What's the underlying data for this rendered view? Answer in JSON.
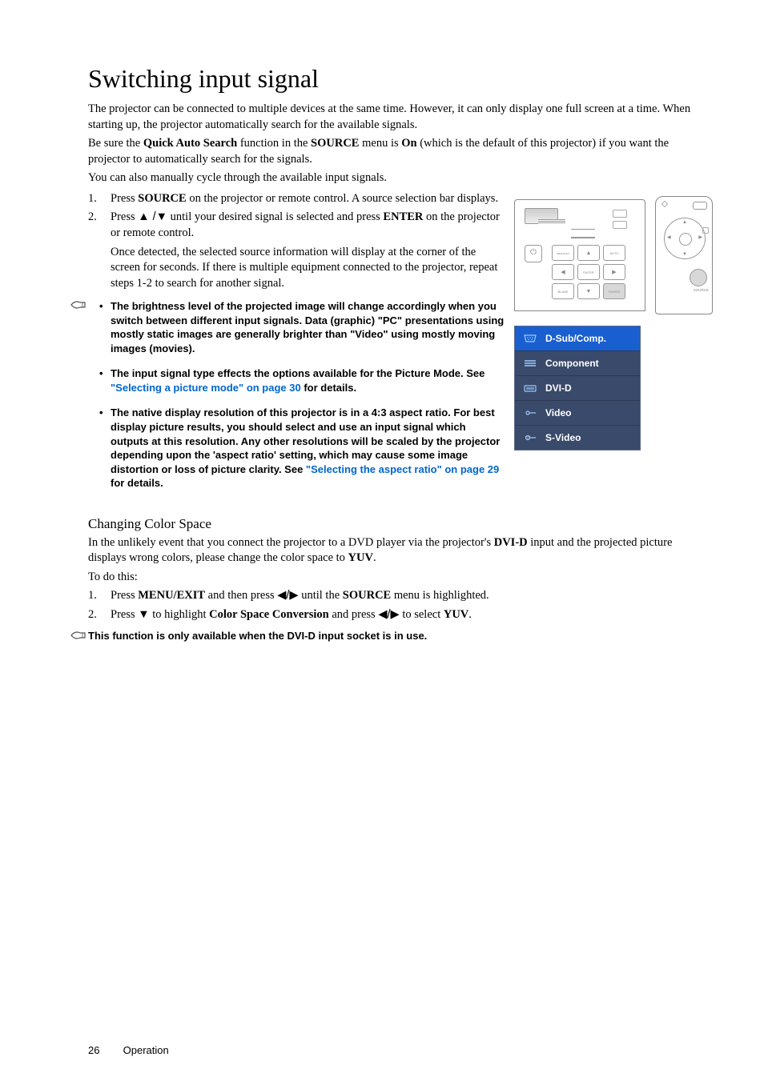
{
  "title": "Switching input signal",
  "intro1": "The projector can be connected to multiple devices at the same time. However, it can only display one full screen at a time. When starting up, the projector automatically search for the available signals.",
  "intro2a": "Be sure the ",
  "intro2b": "Quick Auto Search",
  "intro2c": " function in the ",
  "intro2d": "SOURCE",
  "intro2e": " menu is ",
  "intro2f": "On",
  "intro2g": " (which is the default of this projector) if you want the projector to automatically search for the signals.",
  "intro3": "You can also manually cycle through the available input signals.",
  "step1n": "1.",
  "step1a": "Press ",
  "step1b": "SOURCE",
  "step1c": " on the projector or remote control. A source selection bar displays.",
  "step2n": "2.",
  "step2a": "Press ",
  "step2b": " until your desired signal is selected and press ",
  "step2c": "ENTER",
  "step2d": " on the projector or remote control.",
  "step2cont": "Once detected, the selected source information will display at the corner of the screen for seconds. If there is multiple equipment connected to the projector, repeat steps 1-2 to search for another signal.",
  "bullet1": "The brightness level of the projected image will change accordingly when you switch between different input signals. Data (graphic) \"PC\" presentations using mostly static images are generally brighter than \"Video\" using mostly moving images (movies).",
  "bullet2a": "The input signal type effects the options available for the Picture Mode. See ",
  "bullet2link": "\"Selecting a picture mode\" on page 30",
  "bullet2b": " for details.",
  "bullet3a": "The native display resolution of this projector is in a 4:3 aspect ratio. For best display picture results, you should select and use an input signal which outputs at this resolution. Any other resolutions will be scaled by the projector depending upon the 'aspect ratio' setting, which may cause some image distortion or loss of picture clarity. See ",
  "bullet3link": "\"Selecting the aspect ratio\" on page 29",
  "bullet3b": " for details.",
  "subheading": "Changing Color Space",
  "ccs1a": "In the unlikely event that you connect the projector to a DVD player via the projector's ",
  "ccs1b": "DVI-D",
  "ccs1c": " input and the projected picture displays wrong colors, please change the color space to ",
  "ccs1d": "YUV",
  "ccs1e": ".",
  "ccs2": "To do this:",
  "cstep1n": "1.",
  "cstep1a": "Press ",
  "cstep1b": "MENU/EXIT",
  "cstep1c": " and then press ",
  "cstep1d": " until the ",
  "cstep1e": "SOURCE",
  "cstep1f": " menu is highlighted.",
  "cstep2n": "2.",
  "cstep2a": "Press ",
  "cstep2b": " to highlight ",
  "cstep2c": "Color Space Conversion",
  "cstep2d": " and press ",
  "cstep2e": " to select ",
  "cstep2f": "YUV",
  "cstep2g": ".",
  "finalnote": "This function is only available when the DVI-D input socket is in use.",
  "menu": {
    "item1": "D-Sub/Comp.",
    "item2": "Component",
    "item3": "DVI-D",
    "item4": "Video",
    "item5": "S-Video"
  },
  "remote_label": "SOURCE",
  "footer": {
    "page": "26",
    "section": "Operation"
  }
}
